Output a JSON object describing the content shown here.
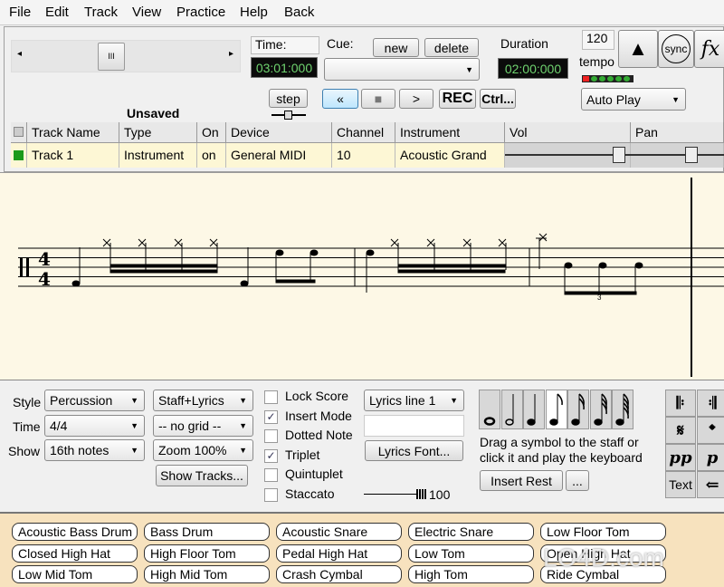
{
  "menu": [
    "File",
    "Edit",
    "Track",
    "View",
    "Practice",
    "Help",
    "Back"
  ],
  "transport": {
    "time_label": "Time:",
    "time_value": "03:01:000",
    "cue_label": "Cue:",
    "cue_new": "new",
    "cue_delete": "delete",
    "cue_value": "",
    "duration_label": "Duration",
    "duration_value": "02:00:000",
    "tempo_value": "120",
    "tempo_label": "tempo",
    "sync_label": "sync",
    "fx_label": "fx",
    "auto_play": "Auto Play",
    "step": "step",
    "rewind": "«",
    "stop": "■",
    "play": ">",
    "rec": "REC",
    "ctrl": "Ctrl..."
  },
  "status": "Unsaved",
  "table": {
    "headers": [
      "Track Name",
      "Type",
      "On",
      "Device",
      "Channel",
      "Instrument",
      "Vol",
      "Pan"
    ],
    "rows": [
      [
        "Track 1",
        "Instrument",
        "on",
        "General MIDI",
        "10",
        "Acoustic Grand"
      ]
    ],
    "track_color": "#1a9a1a"
  },
  "score": {
    "time_signature_top": "4",
    "time_signature_bottom": "4",
    "triplet_number": "3"
  },
  "controls": {
    "style_label": "Style",
    "style_value": "Percussion",
    "time_label": "Time",
    "time_value": "4/4",
    "show_label": "Show",
    "show_value": "16th notes",
    "view_value": "Staff+Lyrics",
    "grid_value": "-- no grid --",
    "zoom_value": "Zoom 100%",
    "show_tracks": "Show Tracks...",
    "checkboxes": [
      {
        "label": "Lock Score",
        "checked": false
      },
      {
        "label": "Insert Mode",
        "checked": true
      },
      {
        "label": "Dotted Note",
        "checked": false
      },
      {
        "label": "Triplet",
        "checked": true
      },
      {
        "label": "Quintuplet",
        "checked": false
      },
      {
        "label": "Staccato",
        "checked": false
      }
    ],
    "lyrics_line": "Lyrics line 1",
    "lyrics_text": "",
    "lyrics_font": "Lyrics Font...",
    "velocity": "100",
    "hint": "Drag a symbol to the staff or click it and play the keyboard",
    "insert_rest": "Insert Rest",
    "more": "...",
    "selected_note": "eighth",
    "symbols": [
      "𝄆",
      "𝄇",
      "𝄋",
      "𝄌",
      "pp",
      "p",
      "Text",
      "⇐"
    ]
  },
  "drums": [
    "Acoustic Bass Drum",
    "Bass Drum",
    "Acoustic Snare",
    "Electric Snare",
    "Low Floor Tom",
    "Closed High Hat",
    "High Floor Tom",
    "Pedal High Hat",
    "Low Tom",
    "Open High Hat",
    "Low Mid Tom",
    "High Mid Tom",
    "Crash Cymbal",
    "High Tom",
    "Ride Cymbal"
  ],
  "watermark": "LO4D.com"
}
